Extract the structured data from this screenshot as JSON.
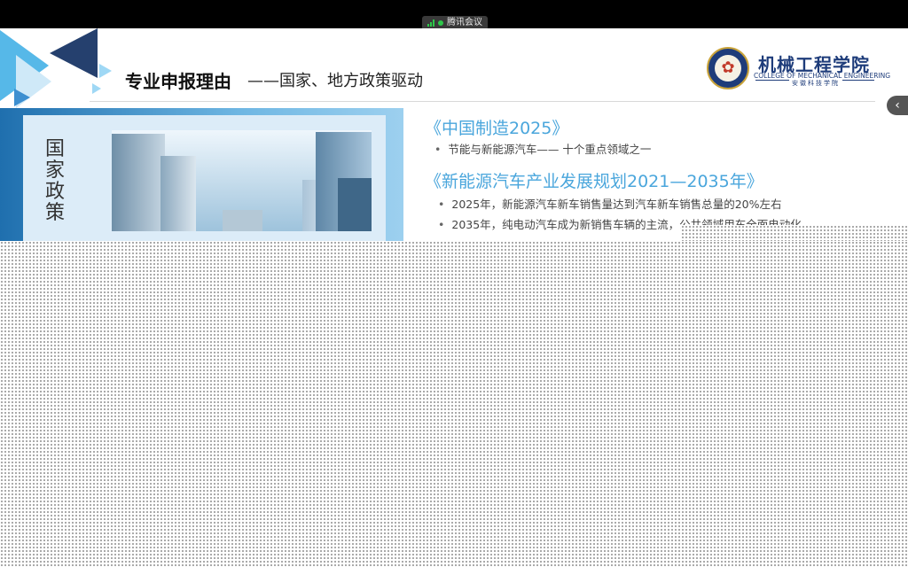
{
  "meeting_bar": {
    "app_name": "腾讯会议",
    "signal_color": "#2ec84a",
    "icons": [
      "signal-icon",
      "recording-dot-icon"
    ]
  },
  "slide": {
    "title": "专业申报理由",
    "subtitle": "——国家、地方政策驱动",
    "logo": {
      "name_cn": "机械工程学院",
      "name_en": "COLLEGE OF MECHANICAL ENGINEERING",
      "signature": "安徽科技学院",
      "emblem_icon": "college-emblem-icon"
    },
    "left_panel_label": "国家政策",
    "policies": [
      {
        "heading": "《中国制造2025》",
        "bullets": [
          "节能与新能源汽车—— 十个重点领域之一"
        ]
      },
      {
        "heading": "《新能源汽车产业发展规划2021—2035年》",
        "bullets": [
          "2025年，新能源汽车新车销售量达到汽车新车销售总量的20%左右",
          "2035年，纯电动汽车成为新销售车辆的主流，公共领域用车全面电动化"
        ]
      }
    ],
    "colors": {
      "heading": "#4aa6dc",
      "college_blue": "#1e3c7a",
      "panel_blue": "#1f6fae"
    }
  },
  "side_panel": {
    "toggle_icon": "chevron-left-icon",
    "toggle_glyph": "‹"
  }
}
